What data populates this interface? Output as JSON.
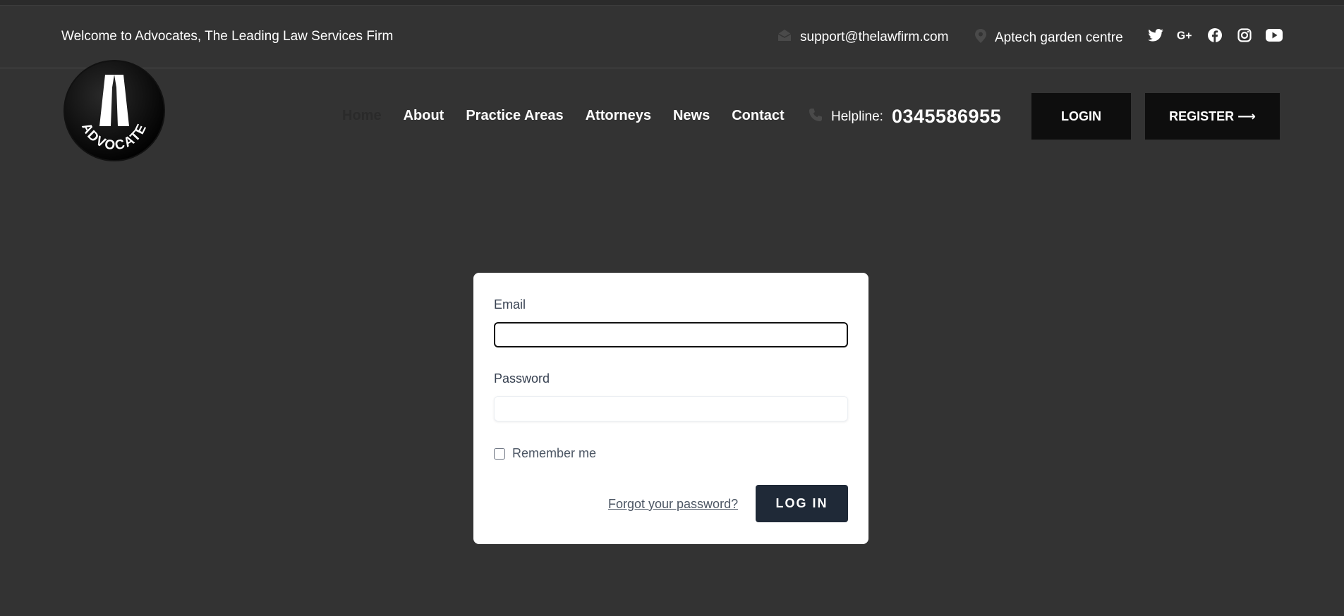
{
  "topbar": {
    "welcome": "Welcome to Advocates, The Leading Law Services Firm",
    "email": "support@thelawfirm.com",
    "address": "Aptech garden centre",
    "socials": [
      "twitter-icon",
      "google-plus-icon",
      "facebook-icon",
      "instagram-icon",
      "youtube-icon"
    ]
  },
  "logo": {
    "text": "ADVOCATE"
  },
  "nav": {
    "items": [
      {
        "label": "Home",
        "active": true
      },
      {
        "label": "About"
      },
      {
        "label": "Practice Areas"
      },
      {
        "label": "Attorneys"
      },
      {
        "label": "News"
      },
      {
        "label": "Contact"
      }
    ]
  },
  "helpline": {
    "label": "Helpline:",
    "number": "0345586955"
  },
  "header_buttons": {
    "login": "LOGIN",
    "register": "REGISTER ⟶"
  },
  "login_form": {
    "email_label": "Email",
    "email_value": "",
    "password_label": "Password",
    "password_value": "",
    "remember_label": "Remember me",
    "forgot_label": "Forgot your password?",
    "submit_label": "LOG IN"
  },
  "colors": {
    "background": "#333333",
    "button_dark": "#0e0e0e",
    "submit": "#1f2937",
    "card": "#ffffff"
  }
}
